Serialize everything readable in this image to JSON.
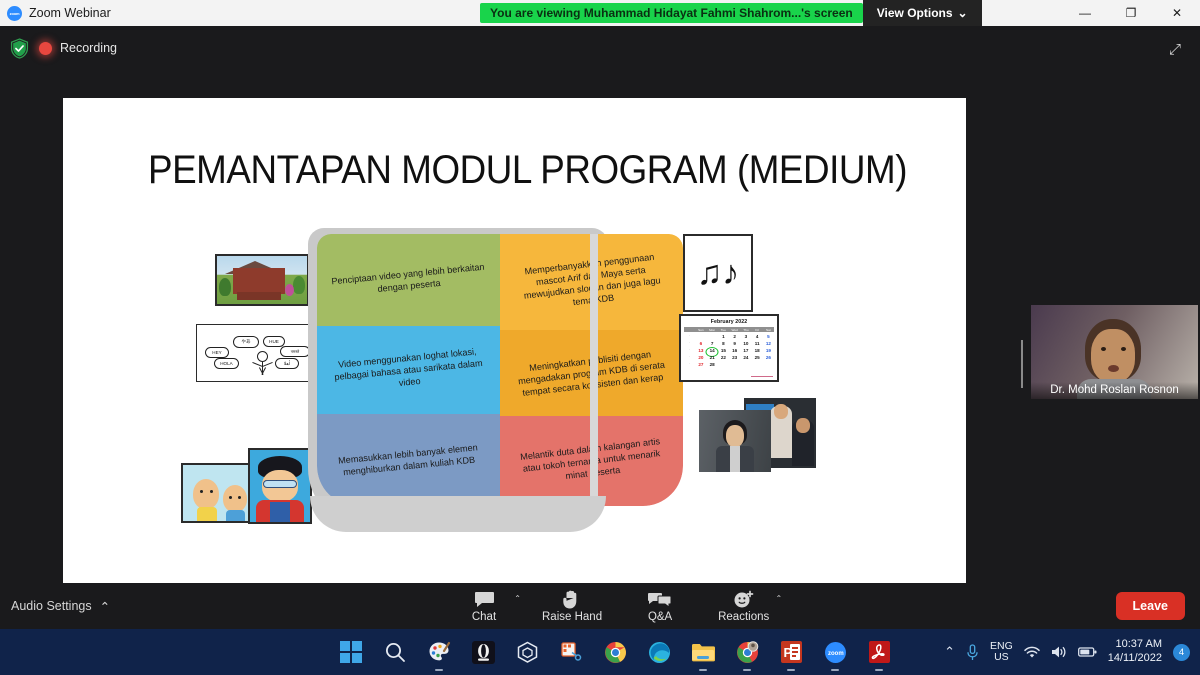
{
  "titlebar": {
    "app_title": "Zoom Webinar",
    "viewing_banner": "You are viewing Muhammad Hidayat Fahmi Shahrom...'s screen",
    "view_options": "View Options",
    "view_options_caret": "⌄",
    "minimize": "—",
    "maximize": "❐",
    "close": "✕"
  },
  "recording_bar": {
    "recording_label": "Recording",
    "expand_icon": "⤢"
  },
  "slide": {
    "title": "PEMANTAPAN MODUL PROGRAM (MEDIUM)",
    "book": {
      "left_page": [
        {
          "color": "#a3bc63",
          "text": "Penciptaan video yang lebih berkaitan dengan peserta"
        },
        {
          "color": "#4cb7e5",
          "text": "Video menggunakan loghat lokasi, pelbagai bahasa atau sarikata dalam video"
        },
        {
          "color": "#7c9ac4",
          "text": "Memasukkan lebih banyak elemen menghiburkan dalam kuliah KDB"
        }
      ],
      "right_page": [
        {
          "color": "#f6b73c",
          "text": "Memperbanyakkan penggunaan mascot  Arif dan Maya serta mewujudkan slogan dan juga lagu tema KDB"
        },
        {
          "color": "#efa92b",
          "text": "Meningkatkan publisiti dengan mengadakan program KDB di serata tempat secara konsisten dan kerap"
        },
        {
          "color": "#e4736a",
          "text": "Melantik duta dalam kalangan artis atau tokoh ternama untuk menarik minat peserta"
        }
      ]
    },
    "media": {
      "house_photo": "traditional-malay-house-photo",
      "speech_bubbles": [
        "HEY",
        "やあ",
        "HUE",
        "HOLA",
        "नमस्ते",
        "أهلا"
      ],
      "cartoon_photo": "upin-ipin-cartoon",
      "hero_photo": "boboiboy-cartoon",
      "music_glyph": "♫♪",
      "calendar": {
        "title": "February 2022",
        "day_headers": [
          "Sun",
          "Mon",
          "Tue",
          "Wed",
          "Thu",
          "Fri",
          "Sat"
        ],
        "weeks": [
          [
            "",
            "",
            "",
            "1",
            "2",
            "3",
            "4",
            "5"
          ],
          [
            "",
            "6",
            "7",
            "8",
            "9",
            "10",
            "11",
            "12"
          ],
          [
            "",
            "13",
            "14",
            "15",
            "16",
            "17",
            "18",
            "19"
          ],
          [
            "",
            "20",
            "21",
            "22",
            "23",
            "24",
            "25",
            "26"
          ],
          [
            "",
            "27",
            "28",
            "",
            "",
            "",
            "",
            ""
          ]
        ],
        "highlighted_day": "14"
      },
      "artist_photo_1": "male-artist-photo",
      "artist_photo_2": "two-men-photo"
    }
  },
  "participant": {
    "name": "Dr. Mohd Roslan Rosnon"
  },
  "controls": {
    "audio_settings": "Audio Settings",
    "audio_caret": "⌃",
    "items": [
      {
        "label": "Chat",
        "icon": "chat-icon",
        "has_caret": true
      },
      {
        "label": "Raise Hand",
        "icon": "raise-hand-icon",
        "has_caret": false
      },
      {
        "label": "Q&A",
        "icon": "qa-icon",
        "has_caret": false
      },
      {
        "label": "Reactions",
        "icon": "reactions-icon",
        "has_caret": true
      }
    ],
    "leave_label": "Leave"
  },
  "taskbar": {
    "icons": [
      {
        "name": "start-button",
        "active": false
      },
      {
        "name": "search-icon",
        "active": false
      },
      {
        "name": "paint-icon",
        "active": true
      },
      {
        "name": "opera-icon",
        "active": false
      },
      {
        "name": "3d-viewer-icon",
        "active": false
      },
      {
        "name": "snipping-tool-icon",
        "active": false
      },
      {
        "name": "chrome-icon",
        "active": false
      },
      {
        "name": "edge-icon",
        "active": false
      },
      {
        "name": "file-explorer-icon",
        "active": true
      },
      {
        "name": "chrome-profile-icon",
        "active": true
      },
      {
        "name": "powerpoint-icon",
        "active": true
      },
      {
        "name": "zoom-icon",
        "active": true
      },
      {
        "name": "acrobat-icon",
        "active": true
      }
    ],
    "tray": {
      "chevron": "⌃",
      "mic_icon": "microphone-icon",
      "language": "ENG",
      "language_sub": "US",
      "wifi_icon": "wifi-icon",
      "volume_icon": "volume-icon",
      "battery_icon": "battery-icon",
      "time": "10:37 AM",
      "date": "14/11/2022",
      "notification_count": "4"
    }
  },
  "colors": {
    "banner_green": "#19d44b",
    "leave_red": "#d93025",
    "taskbar_blue": "#10234a"
  }
}
